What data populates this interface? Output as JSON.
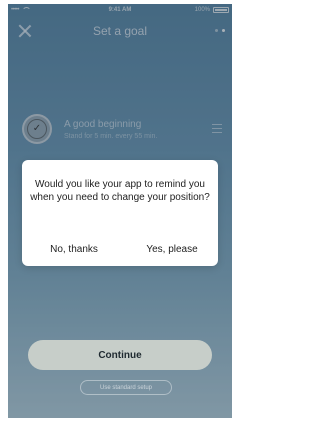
{
  "status_bar": {
    "carrier_dots": "•••••",
    "time": "9:41 AM",
    "battery_text": "100%"
  },
  "nav": {
    "title": "Set a goal",
    "close_icon": "close-icon",
    "page_count": 2,
    "active_page": 2
  },
  "goal": {
    "title": "A good beginning",
    "subtitle": "Stand for 5 min. every 55 min.",
    "icon": "checkmark-icon",
    "settings_icon": "sliders-icon"
  },
  "dialog": {
    "message": "Would you like your app to remind you when you need to change your position?",
    "no_label": "No, thanks",
    "yes_label": "Yes, please"
  },
  "actions": {
    "continue_label": "Continue",
    "standard_setup_label": "Use standard setup"
  },
  "colors": {
    "background_top": "#5d8aa8",
    "background_bottom": "#b5cfdb",
    "dialog_bg": "#ffffff",
    "continue_bg": "#c7cec9"
  }
}
